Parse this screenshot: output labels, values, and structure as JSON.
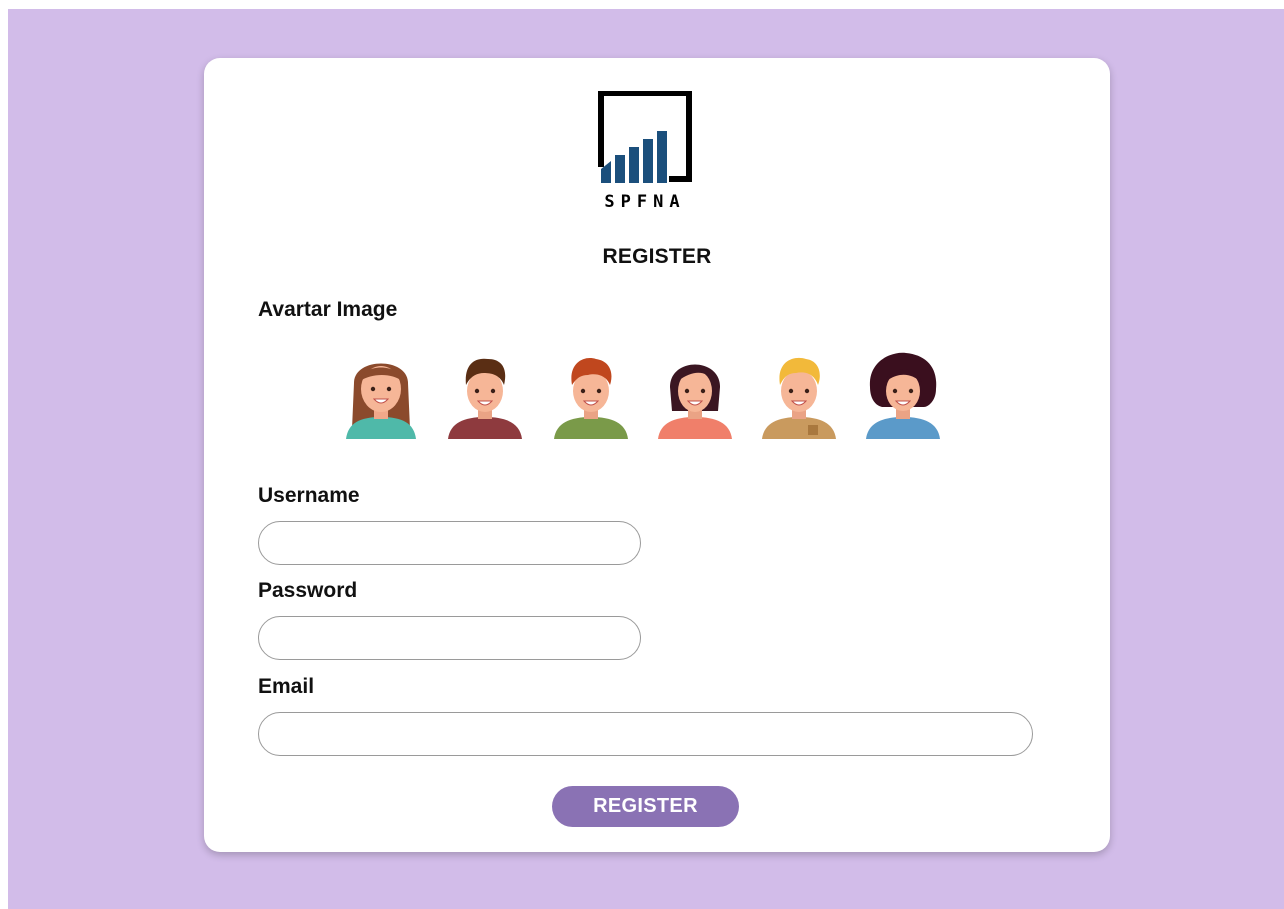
{
  "brand": {
    "name": "SPFNA",
    "primary": "#000000",
    "accent": "#1b4f7c"
  },
  "page": {
    "background": "#d2bce9"
  },
  "form": {
    "heading": "REGISTER",
    "avatar_label": "Avartar Image",
    "avatars": [
      {
        "icon": "girl-long-brown-hair-icon",
        "shirt": "#4fb9a9"
      },
      {
        "icon": "boy-dark-brown-hair-icon",
        "shirt": "#8e3a3e"
      },
      {
        "icon": "boy-red-hair-icon",
        "shirt": "#7a9a49"
      },
      {
        "icon": "girl-dark-bob-hair-icon",
        "shirt": "#f07f6a"
      },
      {
        "icon": "boy-blond-hair-icon",
        "shirt": "#c99a5e"
      },
      {
        "icon": "girl-curly-dark-hair-icon",
        "shirt": "#5b9ac9"
      }
    ],
    "username_label": "Username",
    "username_value": "",
    "password_label": "Password",
    "password_value": "",
    "email_label": "Email",
    "email_value": "",
    "submit_label": "REGISTER",
    "submit_color": "#8a72b4"
  }
}
